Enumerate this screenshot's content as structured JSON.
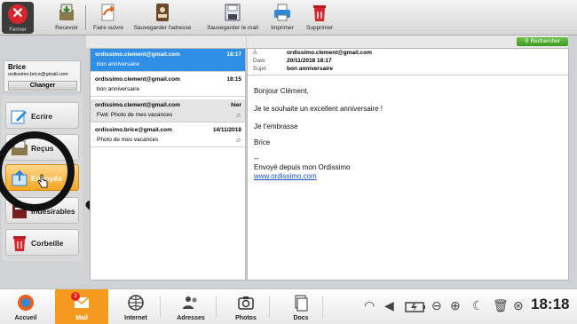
{
  "toolbar": {
    "close_label": "Fermer",
    "buttons": [
      {
        "label": "Recevoir",
        "icon": "inbox-download-icon"
      },
      {
        "label": "Faire suivre",
        "icon": "forward-icon"
      },
      {
        "label": "Sauvegarder l'adresse",
        "icon": "address-book-icon"
      },
      {
        "label": "Sauvegarder le mail",
        "icon": "save-mail-icon"
      },
      {
        "label": "Imprimer",
        "icon": "printer-icon"
      },
      {
        "label": "Supprimer",
        "icon": "trash-icon"
      }
    ]
  },
  "account": {
    "name": "Brice",
    "email": "ordissimo.brice@gmail.com",
    "change_label": "Changer"
  },
  "folders": [
    {
      "label": "Ecrire",
      "icon": "write-icon",
      "color": "#2e8bd8"
    },
    {
      "label": "Reçus",
      "icon": "inbox-icon",
      "color": "#555555"
    },
    {
      "label": "Envoyés",
      "icon": "sent-icon",
      "color": "#2b7fd1"
    },
    {
      "label": "Indésirables",
      "icon": "spam-icon",
      "color": "#7a1d1d"
    },
    {
      "label": "Corbeille",
      "icon": "trash-icon",
      "color": "#d7252b"
    }
  ],
  "messages": [
    {
      "from": "ordissimo.clement@gmail.com",
      "date": "18:17",
      "subject": "bon anniversaire",
      "attachment": false
    },
    {
      "from": "ordissimo.clement@gmail.com",
      "date": "18:15",
      "subject": "bon anniversaire",
      "attachment": false
    },
    {
      "from": "ordissimo.clement@gmail.com",
      "date": "hier",
      "subject": "Fwd: Photo de mes vacances",
      "attachment": true
    },
    {
      "from": "ordissimo.brice@gmail.com",
      "date": "14/11/2018",
      "subject": "Photo de mes vacances",
      "attachment": true
    }
  ],
  "search_label": "Rechercher",
  "reader": {
    "to_key": "À :",
    "to": "ordissimo.clement@gmail.com",
    "date_key": "Date :",
    "date": "20/11/2018 18:17",
    "subject_key": "Sujet :",
    "subject": "bon anniversaire",
    "lines": [
      "Bonjour Clément,",
      "Je te souhaite un excellent anniversaire !",
      "Je t'embrasse",
      "Brice",
      "--",
      "Envoyé depuis mon Ordissimo"
    ],
    "link": "www.ordissimo.com"
  },
  "taskbar": {
    "items": [
      {
        "label": "Accueil",
        "icon": "home-icon"
      },
      {
        "label": "Mail",
        "icon": "mail-icon"
      },
      {
        "label": "Internet",
        "icon": "globe-icon"
      },
      {
        "label": "Adresses",
        "icon": "contacts-icon"
      },
      {
        "label": "Photos",
        "icon": "camera-icon"
      },
      {
        "label": "Docs",
        "icon": "documents-icon"
      }
    ],
    "mail_badge": "3",
    "clock": "18:18"
  },
  "colors": {
    "accent": "#f39a1f",
    "selection": "#2f8fe6",
    "close": "#d7252b"
  }
}
